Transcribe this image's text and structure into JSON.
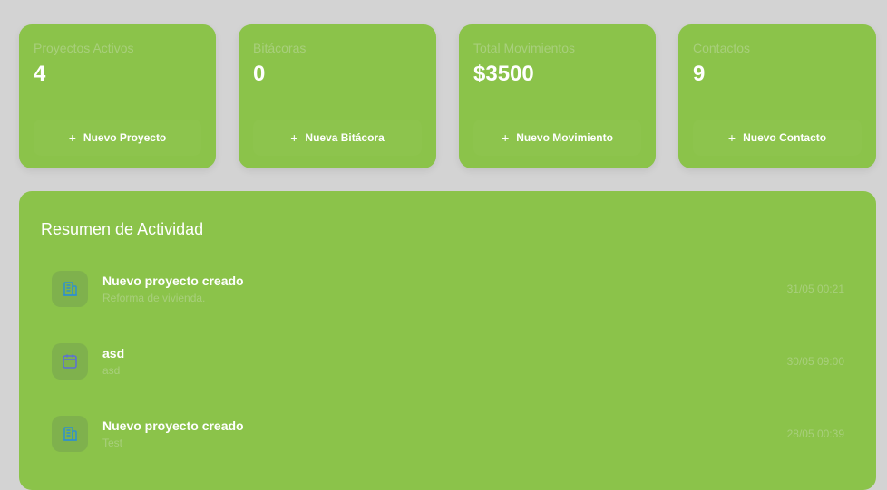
{
  "stats": [
    {
      "label": "Proyectos Activos",
      "value": "4",
      "action": "Nuevo Proyecto"
    },
    {
      "label": "Bitácoras",
      "value": "0",
      "action": "Nueva Bitácora"
    },
    {
      "label": "Total Movimientos",
      "value": "$3500",
      "action": "Nuevo Movimiento"
    },
    {
      "label": "Contactos",
      "value": "9",
      "action": "Nuevo Contacto"
    }
  ],
  "activity": {
    "title": "Resumen de Actividad",
    "items": [
      {
        "icon": "building-icon",
        "title": "Nuevo proyecto creado",
        "subtitle": "Reforma de vivienda.",
        "time": "31/05 00:21"
      },
      {
        "icon": "calendar-icon",
        "title": "asd",
        "subtitle": "asd",
        "time": "30/05 09:00"
      },
      {
        "icon": "building-icon",
        "title": "Nuevo proyecto creado",
        "subtitle": "Test",
        "time": "28/05 00:39"
      }
    ]
  },
  "colors": {
    "background": "#d3d3d3",
    "card": "#8bc34a",
    "muted_text": "#a8cf7c",
    "icon_building": "#2f8fd0",
    "icon_calendar": "#5b6fd6"
  }
}
